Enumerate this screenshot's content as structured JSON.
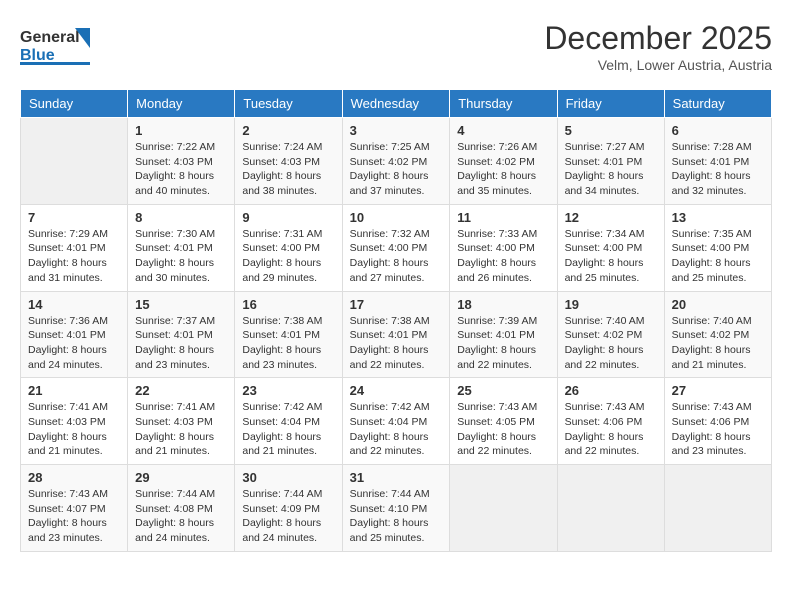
{
  "header": {
    "logo_general": "General",
    "logo_blue": "Blue",
    "month": "December 2025",
    "location": "Velm, Lower Austria, Austria"
  },
  "weekdays": [
    "Sunday",
    "Monday",
    "Tuesday",
    "Wednesday",
    "Thursday",
    "Friday",
    "Saturday"
  ],
  "weeks": [
    [
      {
        "day": "",
        "sunrise": "",
        "sunset": "",
        "daylight": ""
      },
      {
        "day": "1",
        "sunrise": "Sunrise: 7:22 AM",
        "sunset": "Sunset: 4:03 PM",
        "daylight": "Daylight: 8 hours and 40 minutes."
      },
      {
        "day": "2",
        "sunrise": "Sunrise: 7:24 AM",
        "sunset": "Sunset: 4:03 PM",
        "daylight": "Daylight: 8 hours and 38 minutes."
      },
      {
        "day": "3",
        "sunrise": "Sunrise: 7:25 AM",
        "sunset": "Sunset: 4:02 PM",
        "daylight": "Daylight: 8 hours and 37 minutes."
      },
      {
        "day": "4",
        "sunrise": "Sunrise: 7:26 AM",
        "sunset": "Sunset: 4:02 PM",
        "daylight": "Daylight: 8 hours and 35 minutes."
      },
      {
        "day": "5",
        "sunrise": "Sunrise: 7:27 AM",
        "sunset": "Sunset: 4:01 PM",
        "daylight": "Daylight: 8 hours and 34 minutes."
      },
      {
        "day": "6",
        "sunrise": "Sunrise: 7:28 AM",
        "sunset": "Sunset: 4:01 PM",
        "daylight": "Daylight: 8 hours and 32 minutes."
      }
    ],
    [
      {
        "day": "7",
        "sunrise": "Sunrise: 7:29 AM",
        "sunset": "Sunset: 4:01 PM",
        "daylight": "Daylight: 8 hours and 31 minutes."
      },
      {
        "day": "8",
        "sunrise": "Sunrise: 7:30 AM",
        "sunset": "Sunset: 4:01 PM",
        "daylight": "Daylight: 8 hours and 30 minutes."
      },
      {
        "day": "9",
        "sunrise": "Sunrise: 7:31 AM",
        "sunset": "Sunset: 4:00 PM",
        "daylight": "Daylight: 8 hours and 29 minutes."
      },
      {
        "day": "10",
        "sunrise": "Sunrise: 7:32 AM",
        "sunset": "Sunset: 4:00 PM",
        "daylight": "Daylight: 8 hours and 27 minutes."
      },
      {
        "day": "11",
        "sunrise": "Sunrise: 7:33 AM",
        "sunset": "Sunset: 4:00 PM",
        "daylight": "Daylight: 8 hours and 26 minutes."
      },
      {
        "day": "12",
        "sunrise": "Sunrise: 7:34 AM",
        "sunset": "Sunset: 4:00 PM",
        "daylight": "Daylight: 8 hours and 25 minutes."
      },
      {
        "day": "13",
        "sunrise": "Sunrise: 7:35 AM",
        "sunset": "Sunset: 4:00 PM",
        "daylight": "Daylight: 8 hours and 25 minutes."
      }
    ],
    [
      {
        "day": "14",
        "sunrise": "Sunrise: 7:36 AM",
        "sunset": "Sunset: 4:01 PM",
        "daylight": "Daylight: 8 hours and 24 minutes."
      },
      {
        "day": "15",
        "sunrise": "Sunrise: 7:37 AM",
        "sunset": "Sunset: 4:01 PM",
        "daylight": "Daylight: 8 hours and 23 minutes."
      },
      {
        "day": "16",
        "sunrise": "Sunrise: 7:38 AM",
        "sunset": "Sunset: 4:01 PM",
        "daylight": "Daylight: 8 hours and 23 minutes."
      },
      {
        "day": "17",
        "sunrise": "Sunrise: 7:38 AM",
        "sunset": "Sunset: 4:01 PM",
        "daylight": "Daylight: 8 hours and 22 minutes."
      },
      {
        "day": "18",
        "sunrise": "Sunrise: 7:39 AM",
        "sunset": "Sunset: 4:01 PM",
        "daylight": "Daylight: 8 hours and 22 minutes."
      },
      {
        "day": "19",
        "sunrise": "Sunrise: 7:40 AM",
        "sunset": "Sunset: 4:02 PM",
        "daylight": "Daylight: 8 hours and 22 minutes."
      },
      {
        "day": "20",
        "sunrise": "Sunrise: 7:40 AM",
        "sunset": "Sunset: 4:02 PM",
        "daylight": "Daylight: 8 hours and 21 minutes."
      }
    ],
    [
      {
        "day": "21",
        "sunrise": "Sunrise: 7:41 AM",
        "sunset": "Sunset: 4:03 PM",
        "daylight": "Daylight: 8 hours and 21 minutes."
      },
      {
        "day": "22",
        "sunrise": "Sunrise: 7:41 AM",
        "sunset": "Sunset: 4:03 PM",
        "daylight": "Daylight: 8 hours and 21 minutes."
      },
      {
        "day": "23",
        "sunrise": "Sunrise: 7:42 AM",
        "sunset": "Sunset: 4:04 PM",
        "daylight": "Daylight: 8 hours and 21 minutes."
      },
      {
        "day": "24",
        "sunrise": "Sunrise: 7:42 AM",
        "sunset": "Sunset: 4:04 PM",
        "daylight": "Daylight: 8 hours and 22 minutes."
      },
      {
        "day": "25",
        "sunrise": "Sunrise: 7:43 AM",
        "sunset": "Sunset: 4:05 PM",
        "daylight": "Daylight: 8 hours and 22 minutes."
      },
      {
        "day": "26",
        "sunrise": "Sunrise: 7:43 AM",
        "sunset": "Sunset: 4:06 PM",
        "daylight": "Daylight: 8 hours and 22 minutes."
      },
      {
        "day": "27",
        "sunrise": "Sunrise: 7:43 AM",
        "sunset": "Sunset: 4:06 PM",
        "daylight": "Daylight: 8 hours and 23 minutes."
      }
    ],
    [
      {
        "day": "28",
        "sunrise": "Sunrise: 7:43 AM",
        "sunset": "Sunset: 4:07 PM",
        "daylight": "Daylight: 8 hours and 23 minutes."
      },
      {
        "day": "29",
        "sunrise": "Sunrise: 7:44 AM",
        "sunset": "Sunset: 4:08 PM",
        "daylight": "Daylight: 8 hours and 24 minutes."
      },
      {
        "day": "30",
        "sunrise": "Sunrise: 7:44 AM",
        "sunset": "Sunset: 4:09 PM",
        "daylight": "Daylight: 8 hours and 24 minutes."
      },
      {
        "day": "31",
        "sunrise": "Sunrise: 7:44 AM",
        "sunset": "Sunset: 4:10 PM",
        "daylight": "Daylight: 8 hours and 25 minutes."
      },
      {
        "day": "",
        "sunrise": "",
        "sunset": "",
        "daylight": ""
      },
      {
        "day": "",
        "sunrise": "",
        "sunset": "",
        "daylight": ""
      },
      {
        "day": "",
        "sunrise": "",
        "sunset": "",
        "daylight": ""
      }
    ]
  ]
}
